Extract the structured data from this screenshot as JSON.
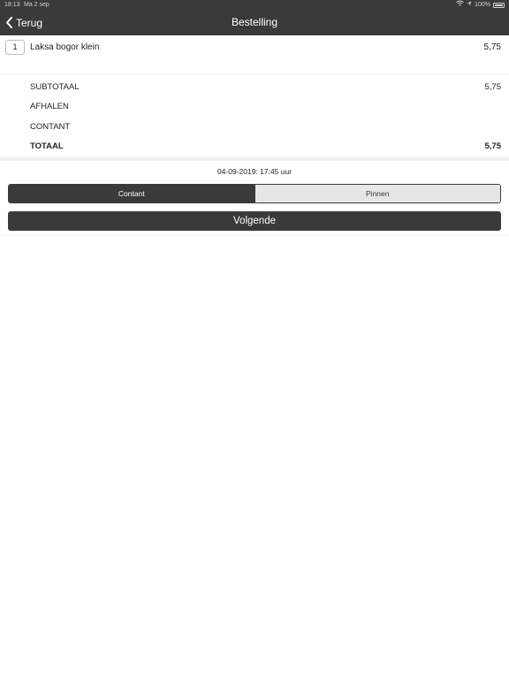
{
  "status_bar": {
    "time": "18:13",
    "date": "Ma 2 sep",
    "battery": "100%"
  },
  "nav": {
    "back_label": "Terug",
    "title": "Bestelling"
  },
  "order": {
    "items": [
      {
        "qty": "1",
        "name": "Laksa bogor klein",
        "price": "5,75"
      }
    ]
  },
  "summary": {
    "subtotal_label": "SUBTOTAAL",
    "subtotal_value": "5,75",
    "pickup_label": "AFHALEN",
    "payment_label": "CONTANT",
    "total_label": "TOTAAL",
    "total_value": "5,75"
  },
  "pickup_datetime": "04-09-2019: 17:45 uur",
  "payment_options": {
    "option1": "Contant",
    "option2": "Pinnen",
    "selected": "Contant"
  },
  "next_button_label": "Volgende",
  "colors": {
    "dark": "#3a3a3a",
    "light_segment": "#e6e6e6",
    "background": "#ffffff"
  }
}
